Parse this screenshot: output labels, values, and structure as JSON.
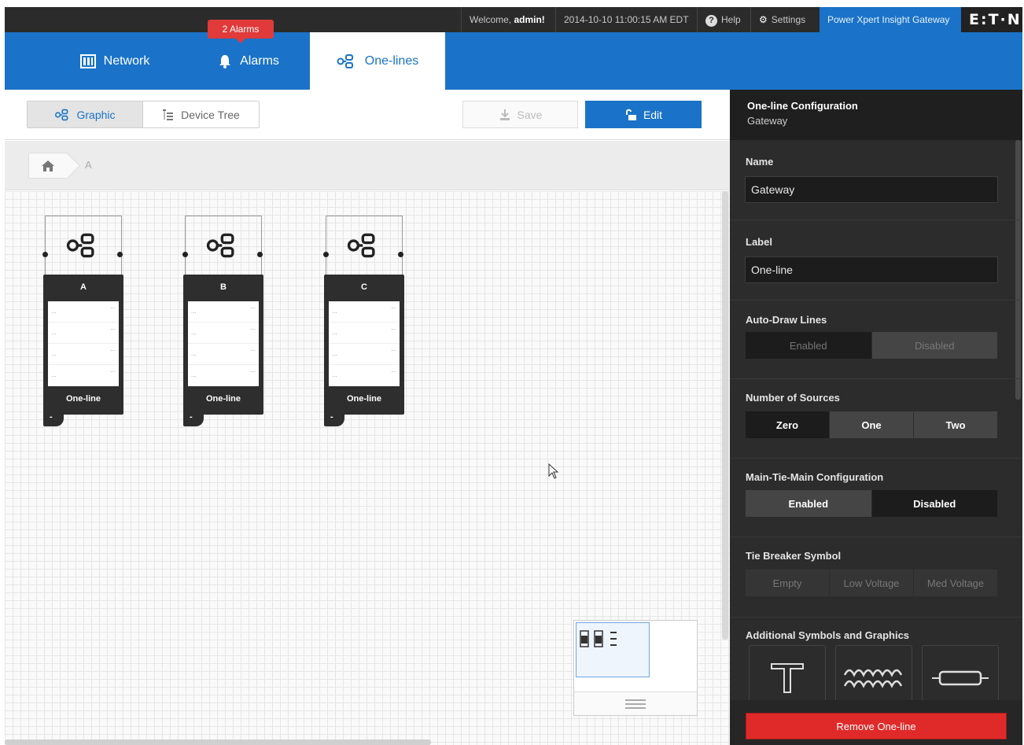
{
  "topbar": {
    "welcome_prefix": "Welcome, ",
    "welcome_user": "admin!",
    "datetime": "2014-10-10 11:00:15 AM EDT",
    "help": "Help",
    "settings": "Settings",
    "gateway": "Power Xpert Insight Gateway",
    "brand": "E:T·N"
  },
  "nav": {
    "alarm_badge": "2 Alarms",
    "tabs": [
      {
        "label": "Network",
        "icon": "network-icon"
      },
      {
        "label": "Alarms",
        "icon": "bell-icon"
      },
      {
        "label": "One-lines",
        "icon": "one-line-icon",
        "active": true
      }
    ]
  },
  "toolbar": {
    "graphic": "Graphic",
    "device_tree": "Device Tree",
    "save": "Save",
    "edit": "Edit"
  },
  "breadcrumb": {
    "current": "A"
  },
  "onelines": [
    {
      "name": "A",
      "label": "One-line",
      "tab": "-"
    },
    {
      "name": "B",
      "label": "One-line",
      "tab": "-"
    },
    {
      "name": "C",
      "label": "One-line",
      "tab": "-"
    }
  ],
  "panel": {
    "title": "One-line Configuration",
    "subtitle": "Gateway",
    "name_label": "Name",
    "name_value": "Gateway",
    "label_label": "Label",
    "label_value": "One-line",
    "autodraw_label": "Auto-Draw Lines",
    "autodraw_options": [
      "Enabled",
      "Disabled"
    ],
    "sources_label": "Number of Sources",
    "sources_options": [
      "Zero",
      "One",
      "Two"
    ],
    "mtm_label": "Main-Tie-Main Configuration",
    "mtm_options": [
      "Enabled",
      "Disabled"
    ],
    "tie_label": "Tie Breaker Symbol",
    "tie_options": [
      "Empty",
      "Low Voltage",
      "Med Voltage"
    ],
    "symbols_label": "Additional Symbols and Graphics",
    "remove": "Remove One-line"
  },
  "colors": {
    "brand_blue": "#1a73c8",
    "topbar": "#2b2b2b",
    "panel": "#2c2c2c",
    "danger": "#e02a2a",
    "alarm": "#e03a3a"
  }
}
